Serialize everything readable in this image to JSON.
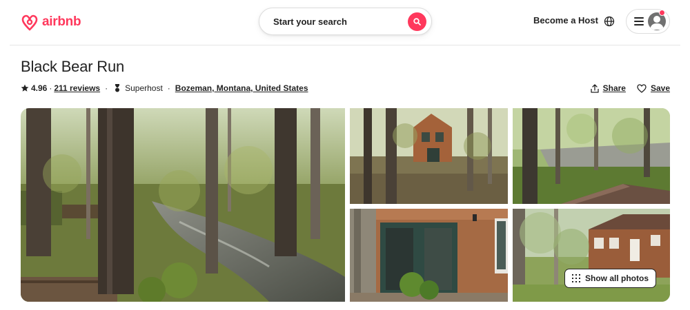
{
  "header": {
    "brand": "airbnb",
    "search_label": "Start your search",
    "host_link": "Become a Host",
    "icons": {
      "logo": "airbnb-logo-icon",
      "search": "search-icon",
      "globe": "globe-icon",
      "menu": "hamburger-menu-icon",
      "avatar": "user-avatar-icon"
    }
  },
  "listing": {
    "title": "Black Bear Run",
    "rating": "4.96",
    "rating_sep": "·",
    "reviews": "211 reviews",
    "superhost": "Superhost",
    "location": "Bozeman, Montana, United States",
    "share_label": "Share",
    "save_label": "Save"
  },
  "gallery": {
    "photos": [
      "creek-through-woods-photo",
      "cabin-in-trees-photo",
      "creek-and-roof-photo",
      "cabin-entrance-photo",
      "cabin-exterior-photo"
    ],
    "show_all_label": "Show all photos"
  },
  "colors": {
    "brand": "#ff385c",
    "text": "#222222",
    "border": "#dddddd"
  }
}
